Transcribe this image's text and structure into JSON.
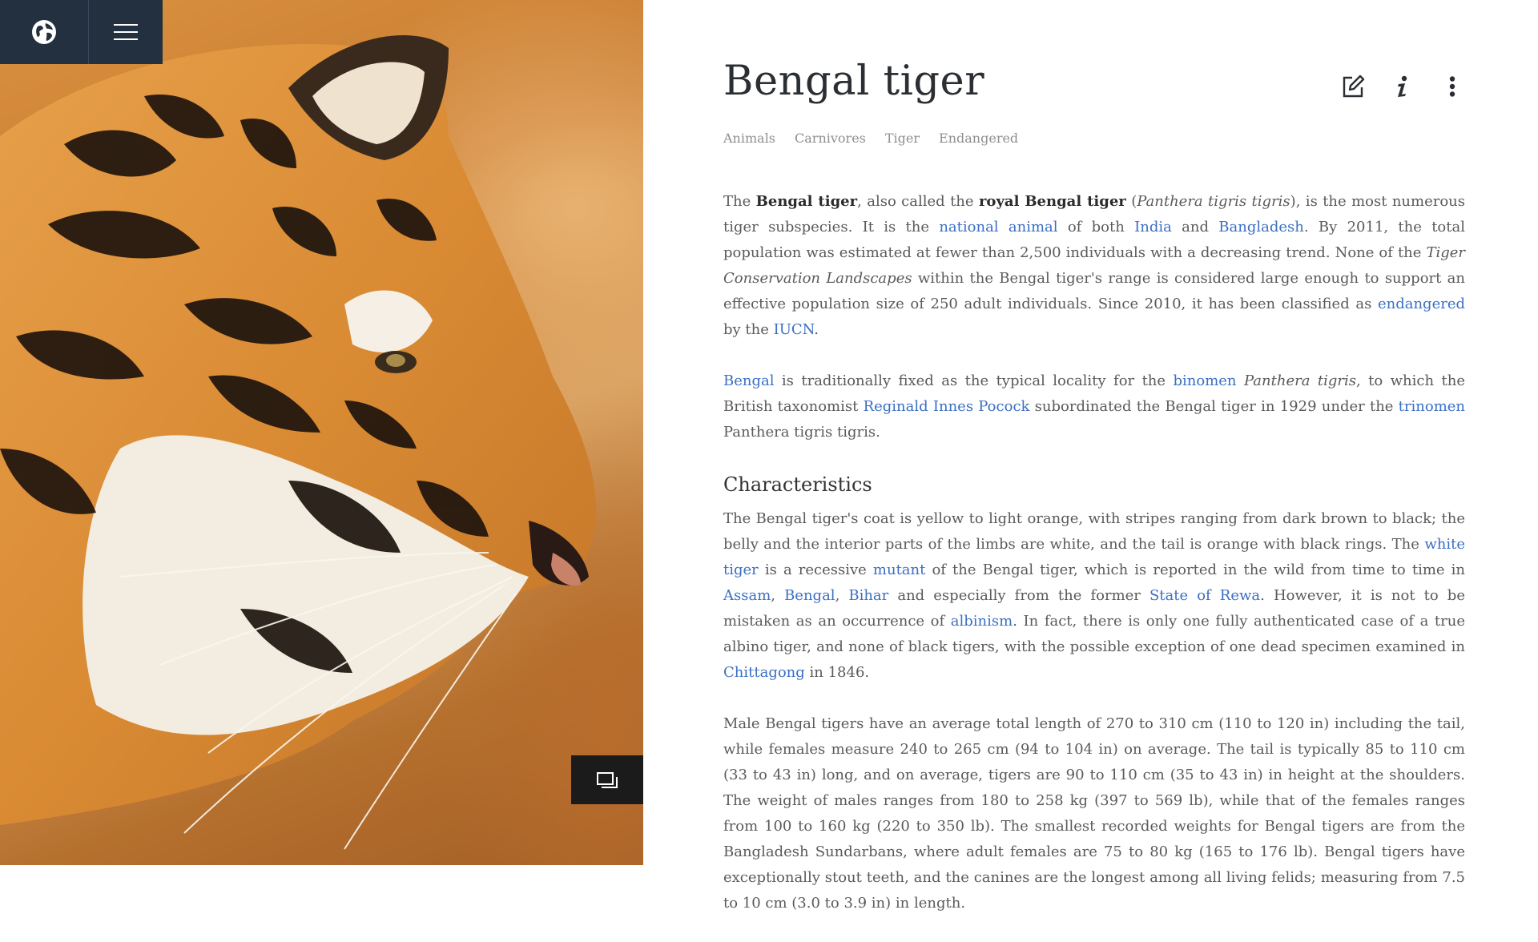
{
  "article": {
    "title": "Bengal tiger",
    "tags": [
      "Animals",
      "Carnivores",
      "Tiger",
      "Endangered"
    ],
    "p1": {
      "t0": "The ",
      "b1": "Bengal tiger",
      "t1": ", also called the ",
      "b2": "royal Bengal tiger",
      "t2": " (",
      "i1": "Panthera tigris tigris",
      "t3": "), is the most numerous tiger subspecies. It is the ",
      "l_national_animal": "national animal",
      "t4": " of both ",
      "l_india": "India",
      "t5": " and ",
      "l_bangladesh": "Bangladesh",
      "t6": ". By 2011, the total population was estimated at fewer than 2,500 individuals with a decreasing trend. None of the ",
      "i2": "Tiger Conservation Landscapes",
      "t7": " within the Bengal tiger's range is considered large enough to support an effective population size of 250 adult individuals. Since 2010, it has been classified as ",
      "l_endangered": "endangered",
      "t8": " by the ",
      "l_iucn": "IUCN",
      "t9": "."
    },
    "p2": {
      "l_bengal": "Bengal",
      "t1": " is traditionally fixed as the typical locality for the ",
      "l_binomen": "binomen",
      "t2": " ",
      "i1": "Panthera tigris",
      "t3": ", to which the British taxonomist ",
      "l_pocock": "Reginald Innes Pocock",
      "t4": " subordinated the Bengal tiger in 1929 under the ",
      "l_trinomen": "trinomen",
      "t5": " Panthera tigris tigris."
    },
    "h_characteristics": "Characteristics",
    "p3": {
      "t0": "The Bengal tiger's coat is yellow to light orange, with stripes ranging from dark brown to black; the belly and the interior parts of the limbs are white, and the tail is orange with black rings. The ",
      "l_white_tiger": "white tiger",
      "t1": " is a recessive ",
      "l_mutant": "mutant",
      "t2": " of the Bengal tiger, which is reported in the wild from time to time in ",
      "l_assam": "Assam",
      "t3": ", ",
      "l_bengal": "Bengal",
      "t4": ", ",
      "l_bihar": "Bihar",
      "t5": " and especially from the former ",
      "l_rewa": "State of Rewa",
      "t6": ". However, it is not to be mistaken as an occurrence of ",
      "l_albinism": "albinism",
      "t7": ". In fact, there is only one fully authenticated case of a true albino tiger, and none of black tigers, with the possible exception of one dead specimen examined in ",
      "l_chittagong": "Chittagong",
      "t8": " in 1846."
    },
    "p4": "Male Bengal tigers have an average total length of 270 to 310 cm (110 to 120 in) including the tail, while females measure 240 to 265 cm (94 to 104 in) on average. The tail is typically 85 to 110 cm (33 to 43 in) long, and on average, tigers are 90 to 110 cm (35 to 43 in) in height at the shoulders. The weight of males ranges from 180 to 258 kg (397 to 569 lb), while that of the females ranges from 100 to 160 kg (220 to 350 lb). The smallest recorded weights for Bengal tigers are from the Bangladesh Sundarbans, where adult females are 75 to 80 kg (165 to 176 lb). Bengal tigers have exceptionally stout teeth, and the canines are the longest among all living felids; measuring from 7.5 to 10 cm (3.0 to 3.9 in) in length."
  },
  "icons": {
    "globe": "globe-icon",
    "menu": "hamburger-menu-icon",
    "edit": "edit-icon",
    "info": "info-icon",
    "more": "more-vertical-icon",
    "gallery": "gallery-icon"
  },
  "colors": {
    "link": "#3b6fc4",
    "topbar": "#233040",
    "title": "#2b2f33"
  }
}
